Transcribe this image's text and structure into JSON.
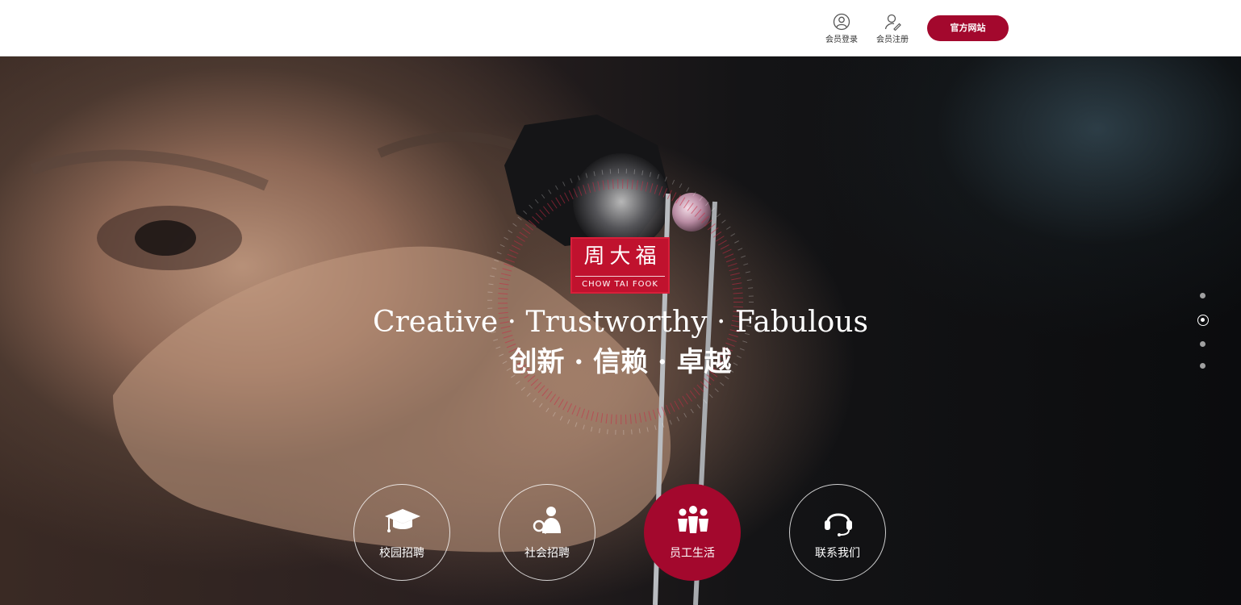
{
  "header": {
    "member_login": {
      "label": "会员登录",
      "icon": "user-circle-icon"
    },
    "member_register": {
      "label": "会员注册",
      "icon": "user-edit-icon"
    },
    "official_site_label": "官方网站",
    "accent_color": "#a3082d"
  },
  "hero": {
    "logo": {
      "cn": "周大福",
      "en": "CHOW TAI FOOK",
      "color": "#c0122e"
    },
    "tagline_en": "Creative · Trustworthy · Fabulous",
    "tagline_cn": "创新 · 信赖 · 卓越"
  },
  "nav": [
    {
      "label": "校园招聘",
      "icon": "graduation-cap-icon",
      "active": false
    },
    {
      "label": "社会招聘",
      "icon": "person-search-icon",
      "active": false
    },
    {
      "label": "员工生活",
      "icon": "group-people-icon",
      "active": true
    },
    {
      "label": "联系我们",
      "icon": "headset-icon",
      "active": false
    }
  ],
  "slider": {
    "slide_count": 4,
    "active_slide": 2
  }
}
